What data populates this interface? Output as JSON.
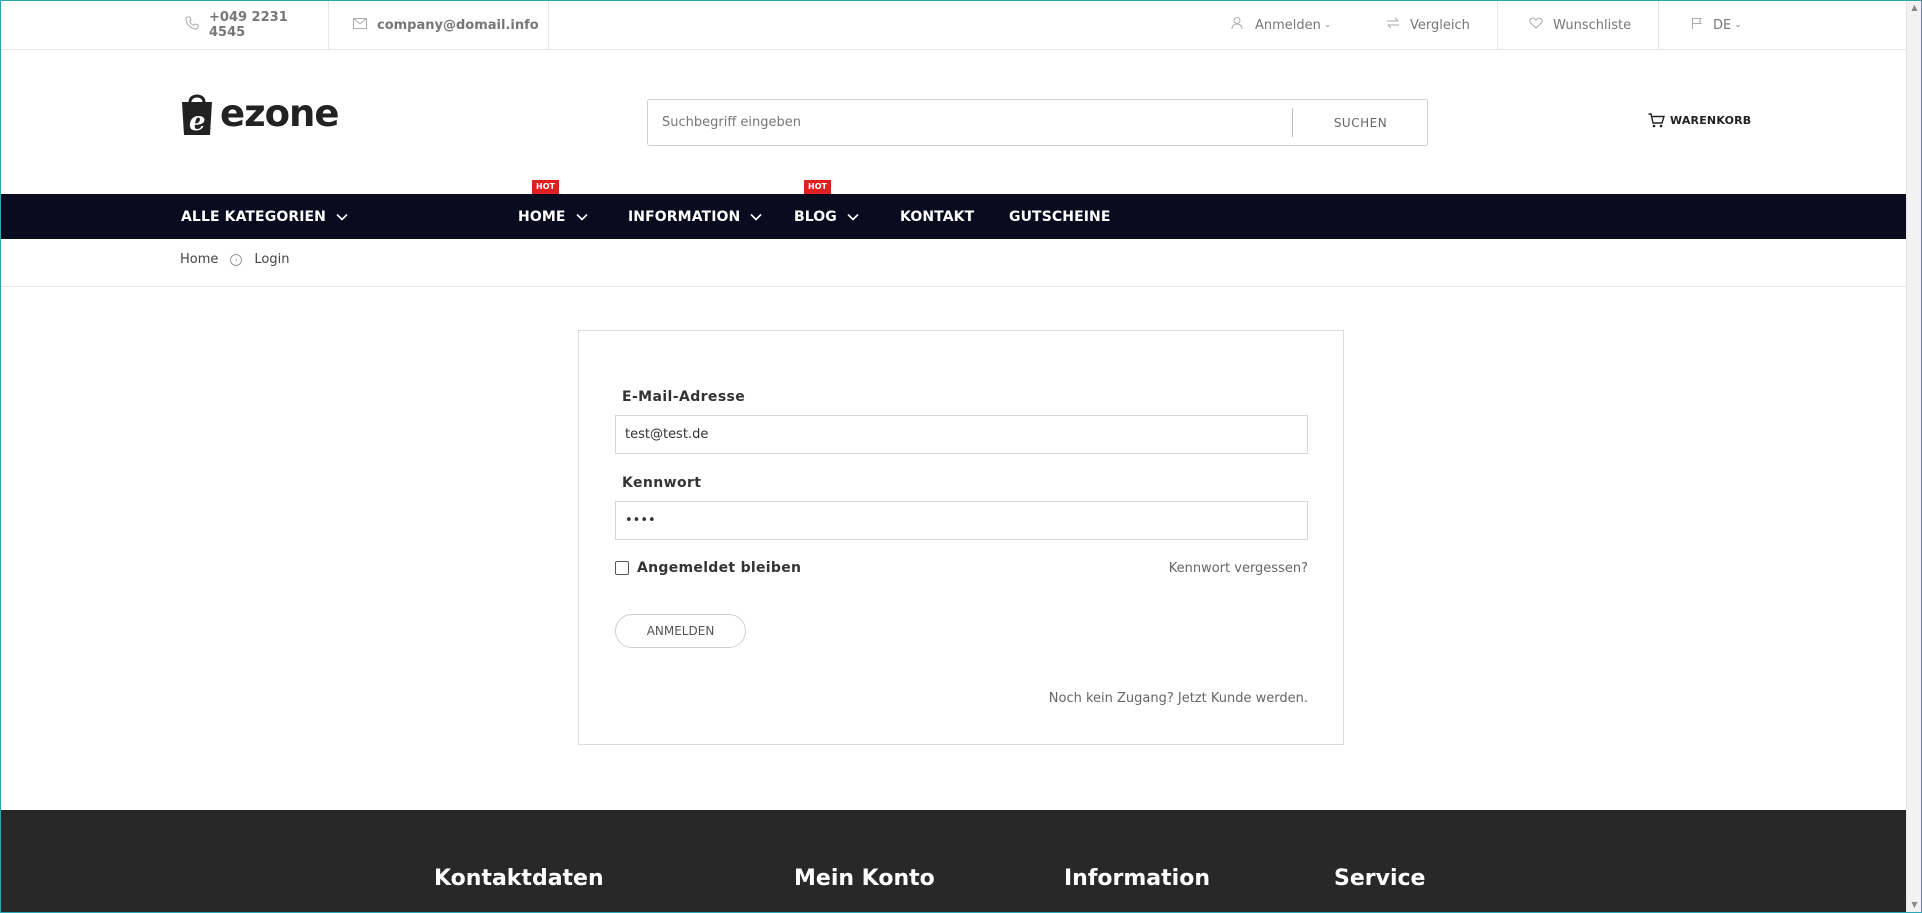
{
  "topbar": {
    "phone": "+049 2231 4545",
    "email": "company@domail.info",
    "login_label": "Anmelden",
    "compare_label": "Vergleich",
    "wishlist_label": "Wunschliste",
    "language": "DE"
  },
  "header": {
    "logo_text": "ezone",
    "search_placeholder": "Suchbegriff eingeben",
    "search_button": "SUCHEN",
    "cart_label": "WARENKORB"
  },
  "nav": {
    "categories_label": "ALLE KATEGORIEN",
    "items": [
      {
        "label": "HOME",
        "badge": "HOT"
      },
      {
        "label": "INFORMATION",
        "badge": ""
      },
      {
        "label": "BLOG",
        "badge": "HOT"
      },
      {
        "label": "KONTAKT",
        "badge": ""
      },
      {
        "label": "GUTSCHEINE",
        "badge": ""
      }
    ]
  },
  "breadcrumb": {
    "items": [
      "Home",
      "Login"
    ]
  },
  "login_form": {
    "email_label": "E-Mail-Adresse",
    "email_value": "test@test.de",
    "password_label": "Kennwort",
    "password_value": "••••",
    "remember_label": "Angemeldet bleiben",
    "remember_checked": false,
    "forgot_link": "Kennwort vergessen?",
    "submit_label": "ANMELDEN",
    "register_link": "Noch kein Zugang? Jetzt Kunde werden."
  },
  "footer": {
    "columns": [
      "Kontaktdaten",
      "Mein Konto",
      "Information",
      "Service"
    ]
  },
  "colors": {
    "nav_background": "#090c1f",
    "hot_badge": "#e02020",
    "footer_background": "#282828"
  }
}
